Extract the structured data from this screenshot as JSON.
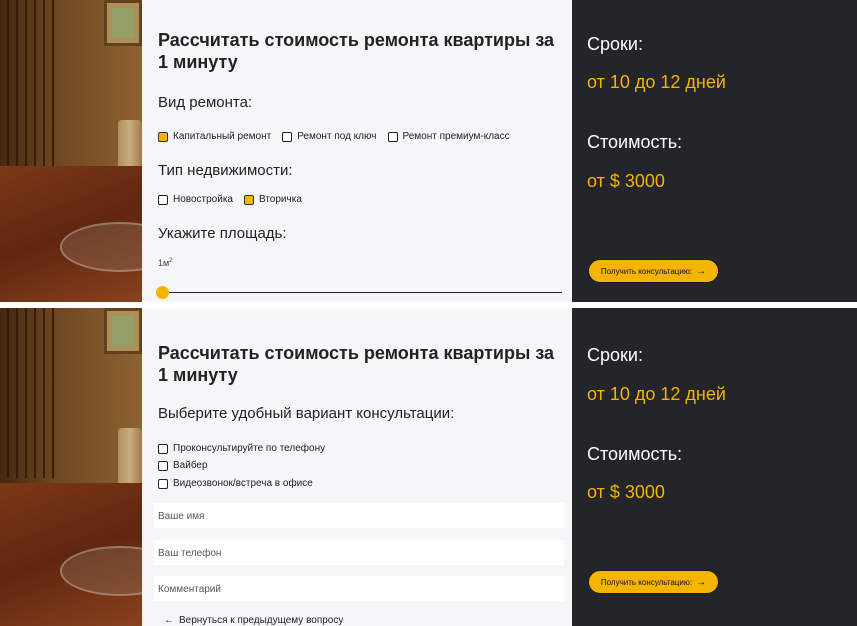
{
  "form": {
    "title": "Рассчитать стоимость ремонта квартиры за 1 минуту",
    "step1": {
      "repair_type_label": "Вид ремонта:",
      "repair_options": [
        {
          "label": "Капитальный ремонт",
          "checked": true
        },
        {
          "label": "Ремонт под ключ",
          "checked": false
        },
        {
          "label": "Ремонт премиум-класс",
          "checked": false
        }
      ],
      "property_type_label": "Тип недвижимости:",
      "property_options": [
        {
          "label": "Новостройка",
          "checked": false
        },
        {
          "label": "Вторичка",
          "checked": true
        }
      ],
      "area_label": "Укажите площадь:",
      "area_value": "1м",
      "area_unit_sup": "2",
      "area_slider_fraction": 0.0
    },
    "step2": {
      "consult_label": "Выберите удобный вариант консультации:",
      "consult_options": [
        {
          "label": "Проконсультируйте по телефону",
          "checked": false
        },
        {
          "label": "Вайбер",
          "checked": false
        },
        {
          "label": "Видеозвонок/встреча в офисе",
          "checked": false
        }
      ],
      "name_placeholder": "Ваше имя",
      "phone_placeholder": "Ваш телефон",
      "comment_placeholder": "Комментарий",
      "back_label": "Вернуться к предыдущему вопросу"
    }
  },
  "info": {
    "terms_label": "Сроки:",
    "terms_value": "от 10 до 12 дней",
    "cost_label": "Стоимость:",
    "cost_value": "от $ 3000",
    "cta_label": "Получить консультацию:",
    "cta_arrow": "→"
  },
  "colors": {
    "accent": "#f5b400",
    "dark_panel": "#23252a",
    "form_bg": "#f4f6f8"
  }
}
